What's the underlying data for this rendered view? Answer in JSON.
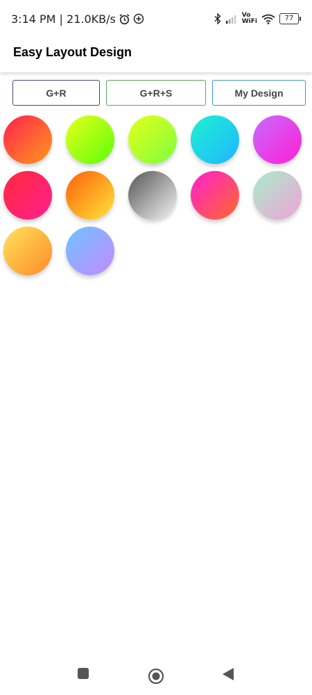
{
  "status_bar": {
    "time_speed": "3:14 PM | 21.0KB/s",
    "vowifi_top": "Vo",
    "vowifi_bottom": "WiFi",
    "battery_level": "77",
    "icons": [
      "alarm-icon",
      "add-circle-icon",
      "bluetooth-icon",
      "signal-icon",
      "vowifi-icon",
      "wifi-icon",
      "battery-icon"
    ]
  },
  "app_bar": {
    "title": "Easy Layout Design"
  },
  "tabs": [
    {
      "label": "G+R",
      "border_color": "#3b4a7a"
    },
    {
      "label": "G+R+S",
      "border_color": "#5aa65e"
    },
    {
      "label": "My Design",
      "border_color": "#3a99c9"
    }
  ],
  "swatches": [
    {
      "name": "red-orange",
      "from": "#ff1f4b",
      "to": "#ff9a1f"
    },
    {
      "name": "yellow-green",
      "from": "#e8ff1a",
      "to": "#5cff0a"
    },
    {
      "name": "lime-green",
      "from": "#e6ff1a",
      "to": "#7dff3d"
    },
    {
      "name": "cyan-blue",
      "from": "#1ff2d1",
      "to": "#1fb5ff"
    },
    {
      "name": "violet-magenta",
      "from": "#c66bff",
      "to": "#ff1fd5"
    },
    {
      "name": "red-pink",
      "from": "#ff2a3a",
      "to": "#ff1f8f"
    },
    {
      "name": "orange-yellow",
      "from": "#ff5f0a",
      "to": "#ffe53a"
    },
    {
      "name": "grey-white",
      "from": "#555555",
      "to": "#f4f4f4"
    },
    {
      "name": "magenta-orange",
      "from": "#ff1fd0",
      "to": "#ff6a2a"
    },
    {
      "name": "mint-pink",
      "from": "#a9ecc9",
      "to": "#f0a3d9"
    },
    {
      "name": "yellow-orange",
      "from": "#ffe35a",
      "to": "#ff8a2a"
    },
    {
      "name": "blue-purple",
      "from": "#6ec3ff",
      "to": "#c58aff"
    }
  ],
  "nav_bar": {
    "recents": "recents-icon",
    "home": "home-icon",
    "back": "back-icon"
  }
}
